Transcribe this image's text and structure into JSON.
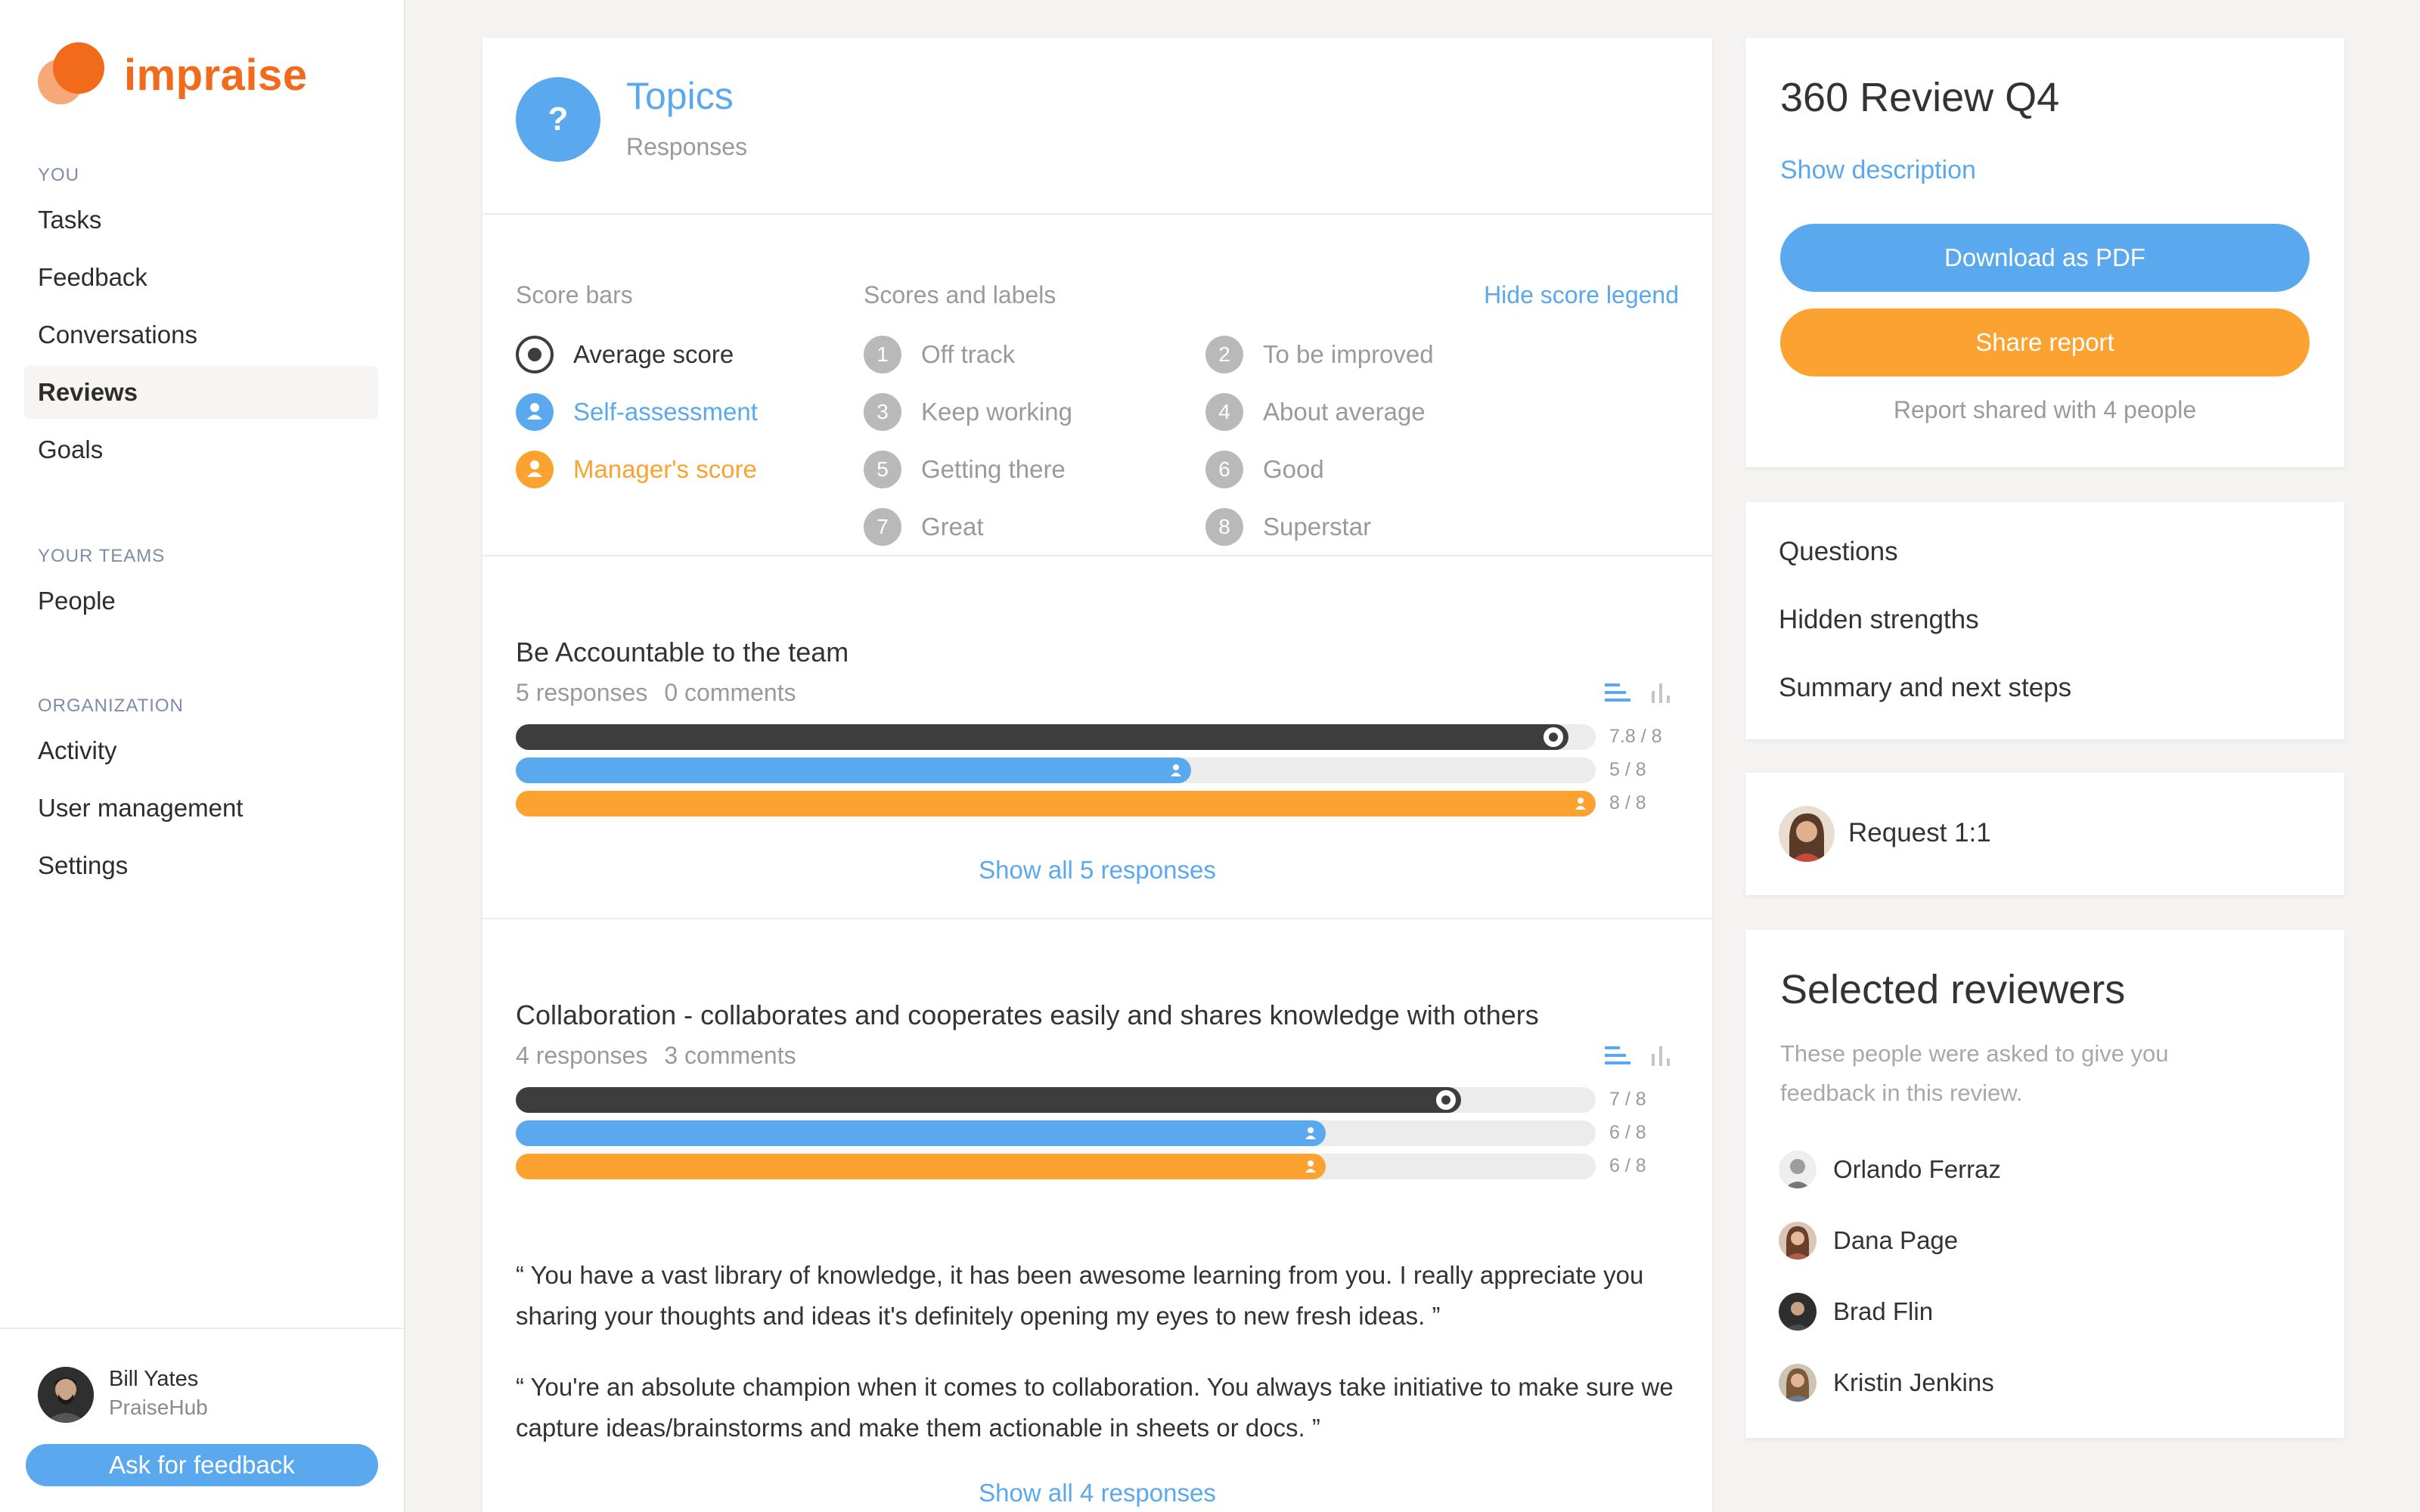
{
  "brand": {
    "name": "impraise",
    "color": "#f26a1b"
  },
  "sidebar": {
    "sections": [
      {
        "heading": "YOU",
        "items": [
          "Tasks",
          "Feedback",
          "Conversations",
          "Reviews",
          "Goals"
        ]
      },
      {
        "heading": "YOUR TEAMS",
        "items": [
          "People"
        ]
      },
      {
        "heading": "ORGANIZATION",
        "items": [
          "Activity",
          "User management",
          "Settings"
        ]
      }
    ],
    "active_item": "Reviews",
    "user": {
      "name": "Bill Yates",
      "org": "PraiseHub"
    },
    "ask_feedback_label": "Ask for feedback"
  },
  "topics": {
    "title": "Topics",
    "subtitle": "Responses",
    "icon": "question-icon"
  },
  "legend": {
    "score_bars_title": "Score bars",
    "scores_labels_title": "Scores and labels",
    "hide_label": "Hide score legend",
    "bars": [
      {
        "label": "Average score",
        "color": "#3d3d3d"
      },
      {
        "label": "Self-assessment",
        "color": "#5aa8ee"
      },
      {
        "label": "Manager's score",
        "color": "#fca230"
      }
    ],
    "scale": [
      {
        "n": "1",
        "label": "Off track"
      },
      {
        "n": "2",
        "label": "To be improved"
      },
      {
        "n": "3",
        "label": "Keep working"
      },
      {
        "n": "4",
        "label": "About average"
      },
      {
        "n": "5",
        "label": "Getting there"
      },
      {
        "n": "6",
        "label": "Good"
      },
      {
        "n": "7",
        "label": "Great"
      },
      {
        "n": "8",
        "label": "Superstar"
      }
    ]
  },
  "questions": [
    {
      "title": "Be Accountable to the team",
      "responses": "5 responses",
      "comments": "0 comments",
      "max": 8,
      "bars": [
        {
          "kind": "average",
          "value": 7.8,
          "label": "7.8 / 8",
          "color": "#3d3d3d"
        },
        {
          "kind": "self",
          "value": 5,
          "label": "5 / 8",
          "color": "#5aa8ee"
        },
        {
          "kind": "manager",
          "value": 8,
          "label": "8 / 8",
          "color": "#fca230"
        }
      ],
      "show_all": "Show all 5 responses",
      "quotes": []
    },
    {
      "title": "Collaboration - collaborates and cooperates easily and shares knowledge with others",
      "responses": "4 responses",
      "comments": "3 comments",
      "max": 8,
      "bars": [
        {
          "kind": "average",
          "value": 7,
          "label": "7 / 8",
          "color": "#3d3d3d"
        },
        {
          "kind": "self",
          "value": 6,
          "label": "6 / 8",
          "color": "#5aa8ee"
        },
        {
          "kind": "manager",
          "value": 6,
          "label": "6 / 8",
          "color": "#fca230"
        }
      ],
      "quotes": [
        "“ You have a vast library of knowledge, it has been awesome learning from you. I really appreciate you sharing your thoughts and ideas it's definitely opening my eyes to new fresh ideas.  ”",
        "“ You're an absolute champion when it comes to collaboration. You always take initiative to make sure we capture ideas/brainstorms and make them actionable in sheets or docs.  ”"
      ],
      "show_all": "Show all 4 responses"
    }
  ],
  "review": {
    "title": "360 Review Q4",
    "show_description": "Show description",
    "download_pdf": "Download as PDF",
    "share_report": "Share report",
    "shared_with": "Report shared with 4 people"
  },
  "question_links": [
    "Questions",
    "Hidden strengths",
    "Summary and next steps"
  ],
  "request": {
    "label": "Request 1:1"
  },
  "reviewers": {
    "title": "Selected reviewers",
    "description": "These people were asked to give you feedback in this review.",
    "people": [
      "Orlando Ferraz",
      "Dana Page",
      "Brad Flin",
      "Kristin Jenkins"
    ]
  }
}
